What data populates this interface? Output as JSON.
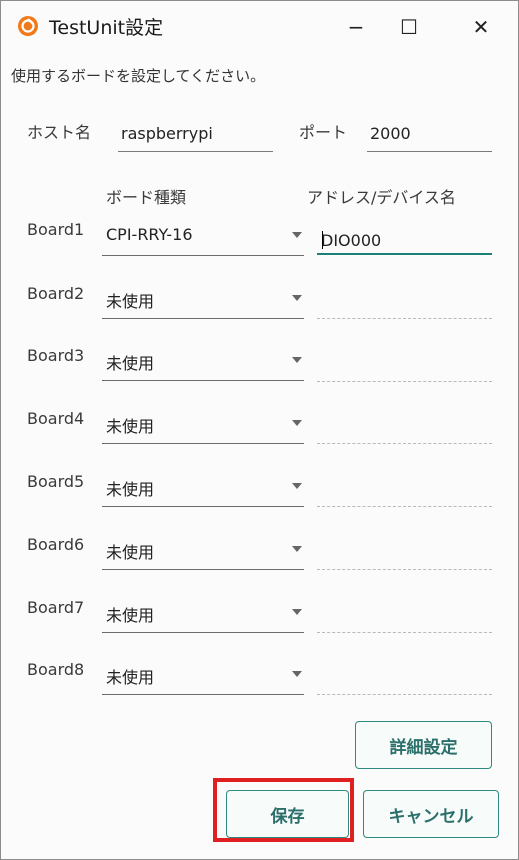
{
  "window": {
    "title": "TestUnit設定",
    "controls": {
      "minimize": "−",
      "maximize": "☐",
      "close": "✕"
    }
  },
  "instruction": "使用するボードを設定してください。",
  "host": {
    "label": "ホスト名",
    "value": "raspberrypi"
  },
  "port": {
    "label": "ポート",
    "value": "2000"
  },
  "headers": {
    "board_type": "ボード種類",
    "address": "アドレス/デバイス名"
  },
  "boards": [
    {
      "label": "Board1",
      "type": "CPI-RRY-16",
      "address": "DIO000"
    },
    {
      "label": "Board2",
      "type": "未使用",
      "address": ""
    },
    {
      "label": "Board3",
      "type": "未使用",
      "address": ""
    },
    {
      "label": "Board4",
      "type": "未使用",
      "address": ""
    },
    {
      "label": "Board5",
      "type": "未使用",
      "address": ""
    },
    {
      "label": "Board6",
      "type": "未使用",
      "address": ""
    },
    {
      "label": "Board7",
      "type": "未使用",
      "address": ""
    },
    {
      "label": "Board8",
      "type": "未使用",
      "address": ""
    }
  ],
  "buttons": {
    "advanced": "詳細設定",
    "save": "保存",
    "cancel": "キャンセル"
  },
  "colors": {
    "accent": "#1e7f78",
    "highlight": "#e02020",
    "app_icon": "#f07a1a"
  }
}
